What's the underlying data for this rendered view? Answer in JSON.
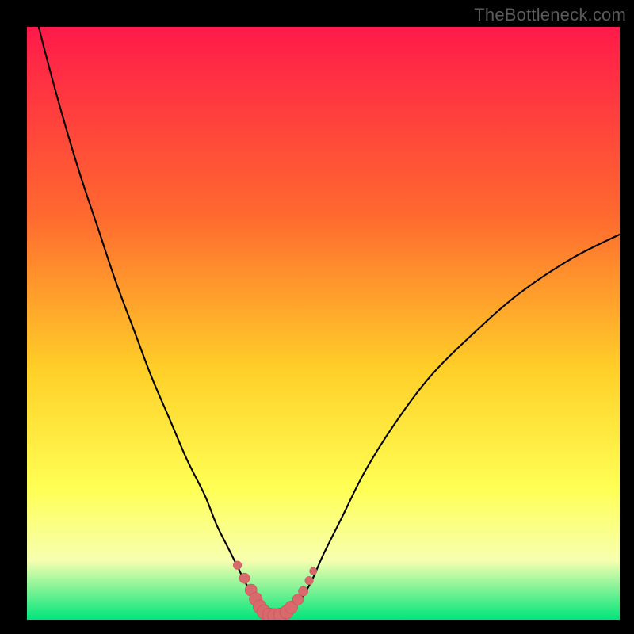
{
  "watermark": "TheBottleneck.com",
  "colors": {
    "frame_bg": "#000000",
    "gradient_top": "#ff1a4a",
    "gradient_mid1": "#ff6a2f",
    "gradient_mid2": "#ffd028",
    "gradient_mid3": "#ffff55",
    "gradient_mid4": "#f7ffb0",
    "gradient_bottom": "#00e57a",
    "curve": "#000000",
    "marker_fill": "#d86a6e",
    "marker_stroke": "#c84f55"
  },
  "chart_data": {
    "type": "line",
    "title": "",
    "xlabel": "",
    "ylabel": "",
    "xlim": [
      0,
      100
    ],
    "ylim": [
      0,
      100
    ],
    "series": [
      {
        "name": "bottleneck-curve",
        "x": [
          0,
          3,
          6,
          9,
          12,
          15,
          18,
          21,
          24,
          27,
          30,
          32,
          34,
          35.5,
          37,
          38.5,
          40,
          41,
          42,
          43,
          44,
          46,
          48,
          50,
          53,
          57,
          62,
          68,
          75,
          83,
          92,
          100
        ],
        "y": [
          108,
          96,
          85,
          75,
          66,
          57,
          49,
          41,
          34,
          27,
          21,
          16,
          12,
          9,
          6,
          4,
          2.2,
          1.2,
          0.7,
          0.7,
          1.2,
          3.2,
          6.5,
          11,
          17,
          25,
          33,
          41,
          48,
          55,
          61,
          65
        ]
      }
    ],
    "markers": {
      "name": "highlight-points",
      "x": [
        35.5,
        36.7,
        37.8,
        38.6,
        39.3,
        40,
        40.9,
        41.8,
        42.8,
        43.8,
        44.6,
        45.7,
        46.6,
        47.6,
        48.3
      ],
      "y": [
        9.2,
        7.0,
        5.0,
        3.5,
        2.2,
        1.3,
        0.8,
        0.7,
        0.8,
        1.3,
        2.1,
        3.4,
        4.8,
        6.6,
        8.2
      ],
      "r": [
        5.2,
        6.5,
        7.5,
        8.2,
        8.6,
        8.8,
        8.9,
        8.9,
        8.9,
        8.6,
        8.0,
        6.8,
        6.0,
        5.2,
        4.6
      ]
    }
  }
}
